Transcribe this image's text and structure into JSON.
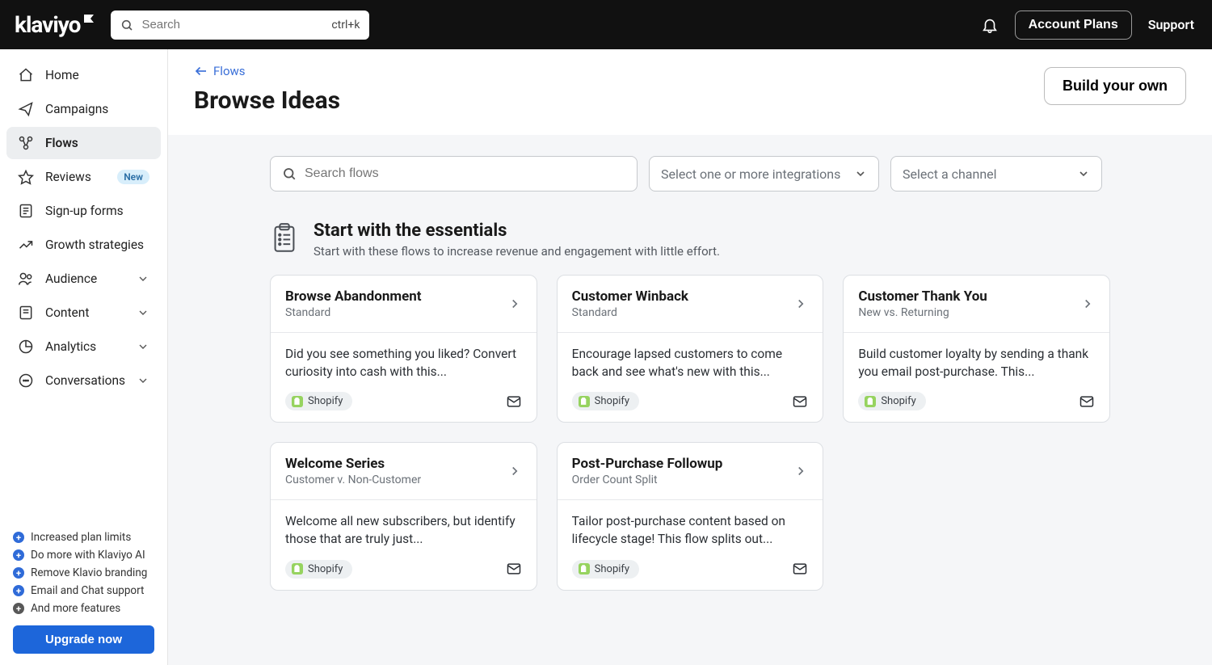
{
  "header": {
    "logo_text": "klaviyo",
    "search_placeholder": "Search",
    "search_shortcut": "ctrl+k",
    "account_plans": "Account Plans",
    "support": "Support"
  },
  "sidebar": {
    "items": [
      {
        "id": "home",
        "label": "Home",
        "icon": "home",
        "expandable": false
      },
      {
        "id": "campaigns",
        "label": "Campaigns",
        "icon": "send",
        "expandable": false
      },
      {
        "id": "flows",
        "label": "Flows",
        "icon": "flow",
        "active": true,
        "expandable": false
      },
      {
        "id": "reviews",
        "label": "Reviews",
        "icon": "star",
        "badge": "New",
        "expandable": false
      },
      {
        "id": "signup",
        "label": "Sign-up forms",
        "icon": "form",
        "expandable": false
      },
      {
        "id": "growth",
        "label": "Growth strategies",
        "icon": "growth",
        "expandable": false
      },
      {
        "id": "audience",
        "label": "Audience",
        "icon": "audience",
        "expandable": true
      },
      {
        "id": "content",
        "label": "Content",
        "icon": "content",
        "expandable": true
      },
      {
        "id": "analytics",
        "label": "Analytics",
        "icon": "analytics",
        "expandable": true
      },
      {
        "id": "conversations",
        "label": "Conversations",
        "icon": "conversations",
        "expandable": true
      }
    ],
    "footer_lines": [
      "Increased plan limits",
      "Do more with Klaviyo AI",
      "Remove Klavio branding",
      "Email and Chat support",
      "And more features"
    ],
    "upgrade_label": "Upgrade now"
  },
  "main": {
    "back_label": "Flows",
    "title": "Browse Ideas",
    "build_button": "Build your own",
    "filters": {
      "search_placeholder": "Search flows",
      "integrations_label": "Select one or more integrations",
      "channel_label": "Select a channel"
    },
    "section": {
      "title": "Start with the essentials",
      "subtitle": "Start with these flows to increase revenue and engagement with little effort."
    },
    "cards": [
      {
        "title": "Browse Abandonment",
        "subtitle": "Standard",
        "desc": "Did you see something you liked? Convert curiosity into cash with this...",
        "tag": "Shopify"
      },
      {
        "title": "Customer Winback",
        "subtitle": "Standard",
        "desc": "Encourage lapsed customers to come back and see what's new with this...",
        "tag": "Shopify"
      },
      {
        "title": "Customer Thank You",
        "subtitle": "New vs. Returning",
        "desc": "Build customer loyalty by sending a thank you email post-purchase. This...",
        "tag": "Shopify"
      },
      {
        "title": "Welcome Series",
        "subtitle": "Customer v. Non-Customer",
        "desc": "Welcome all new subscribers, but identify those that are truly just...",
        "tag": "Shopify"
      },
      {
        "title": "Post-Purchase Followup",
        "subtitle": "Order Count Split",
        "desc": "Tailor post-purchase content based on lifecycle stage! This flow splits out...",
        "tag": "Shopify"
      }
    ]
  }
}
